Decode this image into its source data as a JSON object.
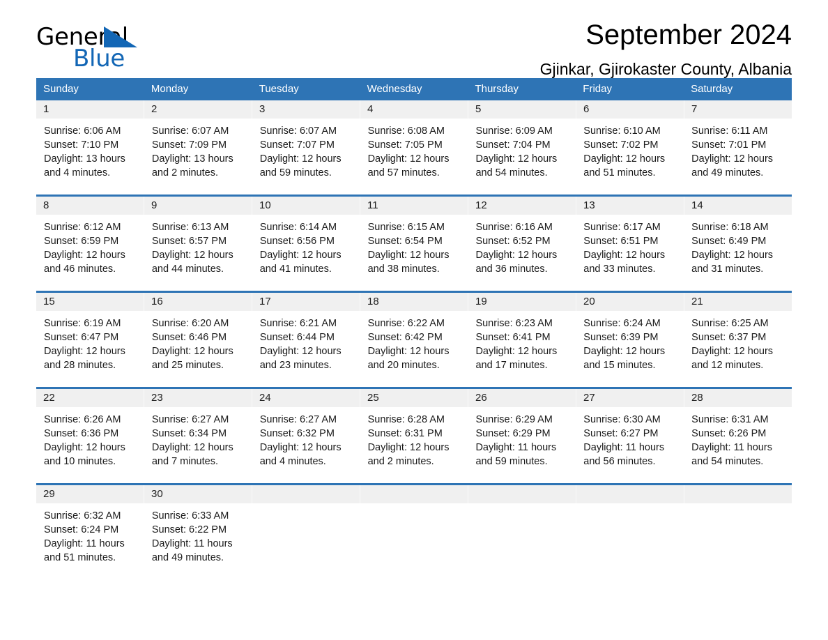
{
  "brand": {
    "name_part1": "General",
    "name_part2": "Blue",
    "triangle_color": "#1266b5",
    "text_color": "#000000"
  },
  "header": {
    "title": "September 2024",
    "subtitle": "Gjinkar, Gjirokaster County, Albania"
  },
  "theme": {
    "header_blue": "#2e74b5",
    "date_band_gray": "#f0f0f0",
    "cell_white": "#ffffff"
  },
  "calendar": {
    "weekday_headers": [
      "Sunday",
      "Monday",
      "Tuesday",
      "Wednesday",
      "Thursday",
      "Friday",
      "Saturday"
    ],
    "weeks": [
      {
        "days": [
          {
            "date": "1",
            "lines": [
              "Sunrise: 6:06 AM",
              "Sunset: 7:10 PM",
              "Daylight: 13 hours",
              "and 4 minutes."
            ]
          },
          {
            "date": "2",
            "lines": [
              "Sunrise: 6:07 AM",
              "Sunset: 7:09 PM",
              "Daylight: 13 hours",
              "and 2 minutes."
            ]
          },
          {
            "date": "3",
            "lines": [
              "Sunrise: 6:07 AM",
              "Sunset: 7:07 PM",
              "Daylight: 12 hours",
              "and 59 minutes."
            ]
          },
          {
            "date": "4",
            "lines": [
              "Sunrise: 6:08 AM",
              "Sunset: 7:05 PM",
              "Daylight: 12 hours",
              "and 57 minutes."
            ]
          },
          {
            "date": "5",
            "lines": [
              "Sunrise: 6:09 AM",
              "Sunset: 7:04 PM",
              "Daylight: 12 hours",
              "and 54 minutes."
            ]
          },
          {
            "date": "6",
            "lines": [
              "Sunrise: 6:10 AM",
              "Sunset: 7:02 PM",
              "Daylight: 12 hours",
              "and 51 minutes."
            ]
          },
          {
            "date": "7",
            "lines": [
              "Sunrise: 6:11 AM",
              "Sunset: 7:01 PM",
              "Daylight: 12 hours",
              "and 49 minutes."
            ]
          }
        ]
      },
      {
        "days": [
          {
            "date": "8",
            "lines": [
              "Sunrise: 6:12 AM",
              "Sunset: 6:59 PM",
              "Daylight: 12 hours",
              "and 46 minutes."
            ]
          },
          {
            "date": "9",
            "lines": [
              "Sunrise: 6:13 AM",
              "Sunset: 6:57 PM",
              "Daylight: 12 hours",
              "and 44 minutes."
            ]
          },
          {
            "date": "10",
            "lines": [
              "Sunrise: 6:14 AM",
              "Sunset: 6:56 PM",
              "Daylight: 12 hours",
              "and 41 minutes."
            ]
          },
          {
            "date": "11",
            "lines": [
              "Sunrise: 6:15 AM",
              "Sunset: 6:54 PM",
              "Daylight: 12 hours",
              "and 38 minutes."
            ]
          },
          {
            "date": "12",
            "lines": [
              "Sunrise: 6:16 AM",
              "Sunset: 6:52 PM",
              "Daylight: 12 hours",
              "and 36 minutes."
            ]
          },
          {
            "date": "13",
            "lines": [
              "Sunrise: 6:17 AM",
              "Sunset: 6:51 PM",
              "Daylight: 12 hours",
              "and 33 minutes."
            ]
          },
          {
            "date": "14",
            "lines": [
              "Sunrise: 6:18 AM",
              "Sunset: 6:49 PM",
              "Daylight: 12 hours",
              "and 31 minutes."
            ]
          }
        ]
      },
      {
        "days": [
          {
            "date": "15",
            "lines": [
              "Sunrise: 6:19 AM",
              "Sunset: 6:47 PM",
              "Daylight: 12 hours",
              "and 28 minutes."
            ]
          },
          {
            "date": "16",
            "lines": [
              "Sunrise: 6:20 AM",
              "Sunset: 6:46 PM",
              "Daylight: 12 hours",
              "and 25 minutes."
            ]
          },
          {
            "date": "17",
            "lines": [
              "Sunrise: 6:21 AM",
              "Sunset: 6:44 PM",
              "Daylight: 12 hours",
              "and 23 minutes."
            ]
          },
          {
            "date": "18",
            "lines": [
              "Sunrise: 6:22 AM",
              "Sunset: 6:42 PM",
              "Daylight: 12 hours",
              "and 20 minutes."
            ]
          },
          {
            "date": "19",
            "lines": [
              "Sunrise: 6:23 AM",
              "Sunset: 6:41 PM",
              "Daylight: 12 hours",
              "and 17 minutes."
            ]
          },
          {
            "date": "20",
            "lines": [
              "Sunrise: 6:24 AM",
              "Sunset: 6:39 PM",
              "Daylight: 12 hours",
              "and 15 minutes."
            ]
          },
          {
            "date": "21",
            "lines": [
              "Sunrise: 6:25 AM",
              "Sunset: 6:37 PM",
              "Daylight: 12 hours",
              "and 12 minutes."
            ]
          }
        ]
      },
      {
        "days": [
          {
            "date": "22",
            "lines": [
              "Sunrise: 6:26 AM",
              "Sunset: 6:36 PM",
              "Daylight: 12 hours",
              "and 10 minutes."
            ]
          },
          {
            "date": "23",
            "lines": [
              "Sunrise: 6:27 AM",
              "Sunset: 6:34 PM",
              "Daylight: 12 hours",
              "and 7 minutes."
            ]
          },
          {
            "date": "24",
            "lines": [
              "Sunrise: 6:27 AM",
              "Sunset: 6:32 PM",
              "Daylight: 12 hours",
              "and 4 minutes."
            ]
          },
          {
            "date": "25",
            "lines": [
              "Sunrise: 6:28 AM",
              "Sunset: 6:31 PM",
              "Daylight: 12 hours",
              "and 2 minutes."
            ]
          },
          {
            "date": "26",
            "lines": [
              "Sunrise: 6:29 AM",
              "Sunset: 6:29 PM",
              "Daylight: 11 hours",
              "and 59 minutes."
            ]
          },
          {
            "date": "27",
            "lines": [
              "Sunrise: 6:30 AM",
              "Sunset: 6:27 PM",
              "Daylight: 11 hours",
              "and 56 minutes."
            ]
          },
          {
            "date": "28",
            "lines": [
              "Sunrise: 6:31 AM",
              "Sunset: 6:26 PM",
              "Daylight: 11 hours",
              "and 54 minutes."
            ]
          }
        ]
      },
      {
        "days": [
          {
            "date": "29",
            "lines": [
              "Sunrise: 6:32 AM",
              "Sunset: 6:24 PM",
              "Daylight: 11 hours",
              "and 51 minutes."
            ]
          },
          {
            "date": "30",
            "lines": [
              "Sunrise: 6:33 AM",
              "Sunset: 6:22 PM",
              "Daylight: 11 hours",
              "and 49 minutes."
            ]
          },
          {
            "date": "",
            "lines": []
          },
          {
            "date": "",
            "lines": []
          },
          {
            "date": "",
            "lines": []
          },
          {
            "date": "",
            "lines": []
          },
          {
            "date": "",
            "lines": []
          }
        ]
      }
    ]
  }
}
